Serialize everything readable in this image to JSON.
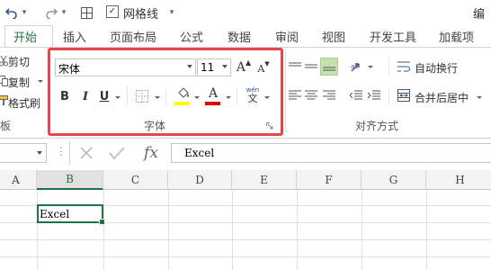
{
  "qat": {
    "undo_icon": "undo-icon",
    "redo_icon": "redo-icon",
    "gridlines_label": "网格线",
    "gridlines_checked": true,
    "title_partial": "编"
  },
  "tabs": [
    {
      "label": "开始",
      "active": true
    },
    {
      "label": "插入"
    },
    {
      "label": "页面布局"
    },
    {
      "label": "公式"
    },
    {
      "label": "数据"
    },
    {
      "label": "审阅"
    },
    {
      "label": "视图"
    },
    {
      "label": "开发工具"
    },
    {
      "label": "加载项"
    }
  ],
  "clipboard": {
    "cut": "剪切",
    "copy": "复制",
    "format_painter": "格式刷",
    "group_label_partial": "板"
  },
  "font": {
    "font_name": "宋体",
    "font_size": "11",
    "bold": "B",
    "italic": "I",
    "underline": "U",
    "font_color_letter": "A",
    "phonetic_top": "wén",
    "phonetic_bottom": "文",
    "group_label": "字体",
    "highlight_color": "#ffff00",
    "font_color": "#e00000"
  },
  "alignment": {
    "wrap_text": "自动换行",
    "merge_center": "合并后居中",
    "group_label": "对齐方式"
  },
  "formula_bar": {
    "fx_label": "fx",
    "content": "Excel"
  },
  "sheet": {
    "columns": [
      "A",
      "B",
      "C",
      "D",
      "E",
      "F",
      "G",
      "H"
    ],
    "selected_column": "B",
    "active_cell_value": "Excel"
  }
}
